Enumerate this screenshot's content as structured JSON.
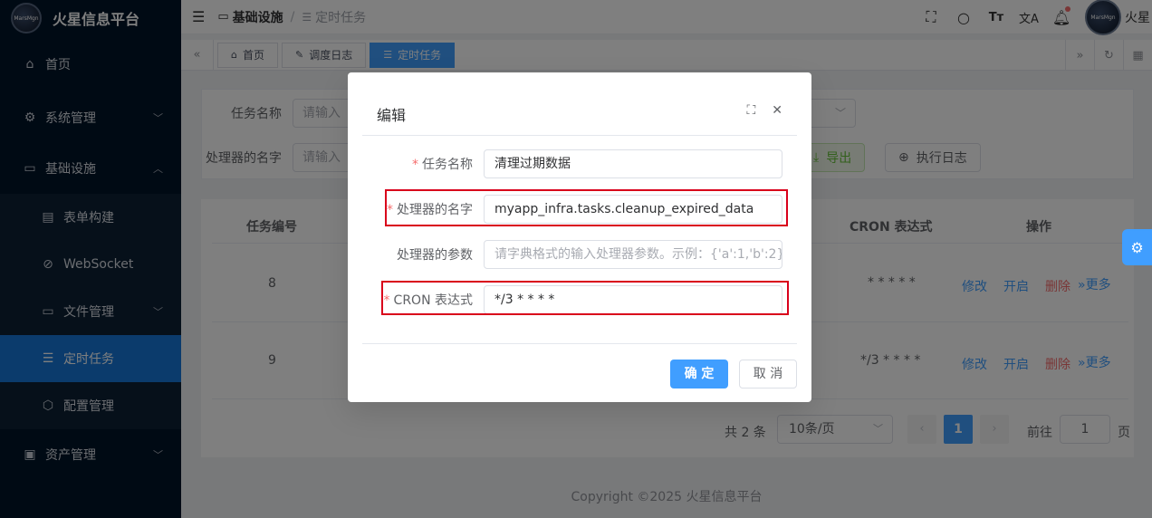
{
  "brand": {
    "title": "火星信息平台",
    "logo_text": "MarsMgn"
  },
  "sidebar": {
    "items": [
      {
        "label": "首页",
        "icon": "home-icon"
      },
      {
        "label": "系统管理",
        "icon": "gear-icon"
      },
      {
        "label": "基础设施",
        "icon": "monitor-icon"
      }
    ],
    "sub_items": [
      {
        "label": "表单构建",
        "icon": "form-icon"
      },
      {
        "label": "WebSocket",
        "icon": "link-icon"
      },
      {
        "label": "文件管理",
        "icon": "folder-icon"
      },
      {
        "label": "定时任务",
        "icon": "list-icon",
        "active": true
      },
      {
        "label": "配置管理",
        "icon": "config-icon"
      }
    ],
    "bottom": {
      "label": "资产管理",
      "icon": "asset-icon"
    }
  },
  "header": {
    "breadcrumb": [
      "基础设施",
      "定时任务"
    ],
    "user_name": "火星",
    "avatar_text": "MarsMgn"
  },
  "tags": [
    {
      "label": "首页",
      "icon": "home-icon"
    },
    {
      "label": "调度日志",
      "icon": "edit-icon"
    },
    {
      "label": "定时任务",
      "icon": "list-icon",
      "active": true
    }
  ],
  "search": {
    "task_name_label": "任务名称",
    "task_name_placeholder": "请输入",
    "handler_label": "处理器的名字",
    "handler_placeholder": "请输入",
    "export_label": "导出",
    "log_label": "执行日志"
  },
  "table": {
    "headers": {
      "id": "任务编号",
      "cron": "CRON 表达式",
      "ops": "操作"
    },
    "rows": [
      {
        "id": "8",
        "cron": "* * * * *"
      },
      {
        "id": "9",
        "cron": "*/3 * * * *"
      }
    ],
    "actions": {
      "edit": "修改",
      "start": "开启",
      "delete": "删除",
      "more": "更多"
    }
  },
  "pagination": {
    "total": "共 2 条",
    "page_size": "10条/页",
    "current": "1",
    "goto_label": "前往",
    "goto_value": "1",
    "page_suffix": "页"
  },
  "footer": "Copyright ©2025 火星信息平台",
  "dialog": {
    "title": "编辑",
    "fields": {
      "name": {
        "label": "任务名称",
        "value": "清理过期数据"
      },
      "handler_name": {
        "label": "处理器的名字",
        "value": "myapp_infra.tasks.cleanup_expired_data"
      },
      "handler_param": {
        "label": "处理器的参数",
        "placeholder": "请字典格式的输入处理器参数。示例：{'a':1,'b':2}"
      },
      "cron": {
        "label": "CRON 表达式",
        "value": "*/3 * * * *"
      }
    },
    "ok": "确 定",
    "cancel": "取 消"
  },
  "colors": {
    "primary": "#409eff",
    "danger": "#f56c6c",
    "success": "#67c23a",
    "sidebar": "#001529",
    "highlight": "#d9001b"
  }
}
